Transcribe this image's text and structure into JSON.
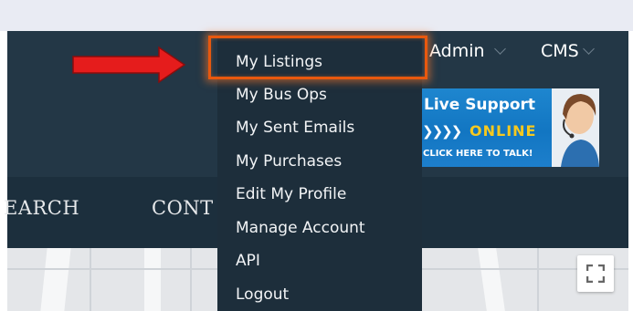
{
  "header": {
    "admin_label": "Admin",
    "cms_label": "CMS"
  },
  "account_menu": {
    "items": [
      {
        "label": "My Listings"
      },
      {
        "label": "My Bus Ops"
      },
      {
        "label": "My Sent Emails"
      },
      {
        "label": "My Purchases"
      },
      {
        "label": "Edit My Profile"
      },
      {
        "label": "Manage Account"
      },
      {
        "label": "API"
      },
      {
        "label": "Logout"
      }
    ]
  },
  "nav": {
    "search_label": "EARCH",
    "contact_label": "CONT"
  },
  "live_support": {
    "title": "Live Support",
    "arrows": "❯❯❯❯",
    "status": "ONLINE",
    "cta": "CLICK HERE TO TALK!"
  },
  "colors": {
    "header_bg": "#233746",
    "dropdown_bg": "#1d2e3b",
    "highlight": "#e8580e",
    "arrow": "#e51c1c",
    "support_blue": "#1276c2",
    "online_yellow": "#f6c91f"
  }
}
